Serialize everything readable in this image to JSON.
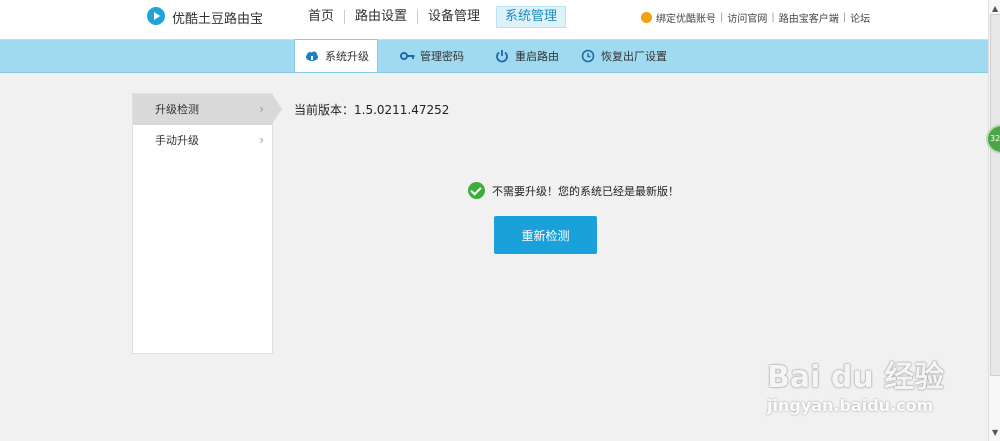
{
  "header": {
    "brand": "优酷土豆路由宝",
    "nav": [
      {
        "label": "首页"
      },
      {
        "label": "路由设置"
      },
      {
        "label": "设备管理"
      },
      {
        "label": "系统管理",
        "active": true
      }
    ],
    "links": [
      "绑定优酷账号",
      "访问官网",
      "路由宝客户端",
      "论坛"
    ]
  },
  "subnav": {
    "items": [
      {
        "label": "系统升级",
        "icon": "cloud-upgrade-icon",
        "active": true
      },
      {
        "label": "管理密码",
        "icon": "key-icon"
      },
      {
        "label": "重启路由",
        "icon": "power-icon"
      },
      {
        "label": "恢复出厂设置",
        "icon": "restore-icon"
      }
    ]
  },
  "sidebar": {
    "items": [
      {
        "label": "升级检测",
        "active": true
      },
      {
        "label": "手动升级"
      }
    ]
  },
  "main": {
    "version": "当前版本：1.5.0211.47252",
    "status": "不需要升级！您的系统已经是最新版！",
    "recheck_label": "重新检测"
  },
  "float_badge": "32",
  "watermark": {
    "logo": "Bai du 经验",
    "url": "jingyan.baidu.com"
  },
  "colors": {
    "accent": "#1aa1d9",
    "subnav_bg": "#9fdaf0",
    "success": "#3dad3c"
  }
}
